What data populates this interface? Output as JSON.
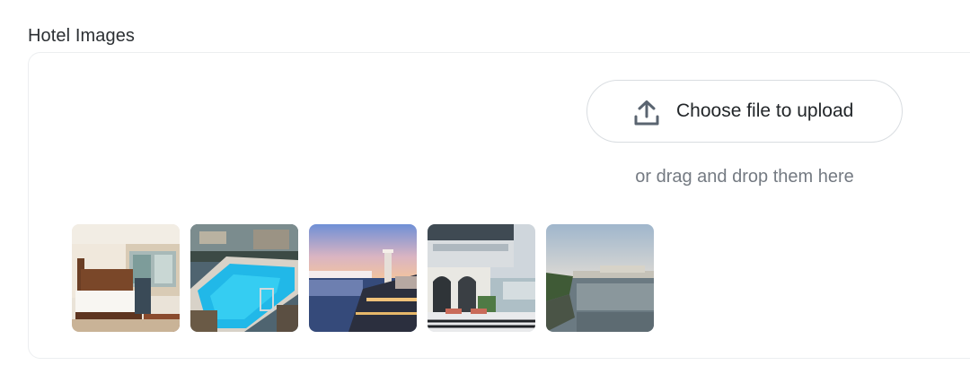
{
  "section": {
    "label": "Hotel Images"
  },
  "upload": {
    "button_label": "Choose file to upload",
    "icon": "upload-icon",
    "hint": "or drag and drop them here"
  },
  "images": [
    {
      "name": "hotel-bedroom-thumbnail"
    },
    {
      "name": "rooftop-pool-thumbnail"
    },
    {
      "name": "lakeside-dusk-thumbnail"
    },
    {
      "name": "terrace-restaurant-thumbnail"
    },
    {
      "name": "lake-view-thumbnail"
    }
  ]
}
